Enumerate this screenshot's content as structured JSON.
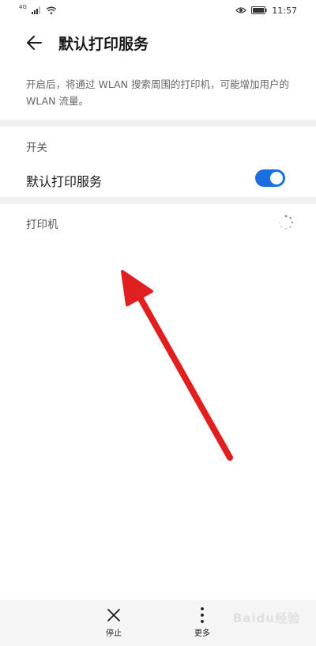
{
  "status_bar": {
    "network_label": "4G",
    "time": "11:57",
    "icons": [
      "signal-icon",
      "wifi-icon",
      "eye-icon",
      "battery-icon"
    ]
  },
  "header": {
    "title": "默认打印服务",
    "back_icon": "arrow-left-icon"
  },
  "description": "开启后，将通过 WLAN 搜索周围的打印机，可能增加用户的 WLAN 流量。",
  "switch_section": {
    "label": "开关",
    "row_label": "默认打印服务",
    "enabled": true,
    "accent_color": "#1a6fe0"
  },
  "printers_section": {
    "label": "打印机",
    "loading_icon": "spinner-icon"
  },
  "bottom_bar": {
    "stop_label": "停止",
    "more_label": "更多"
  },
  "watermark": "Baidu经验"
}
